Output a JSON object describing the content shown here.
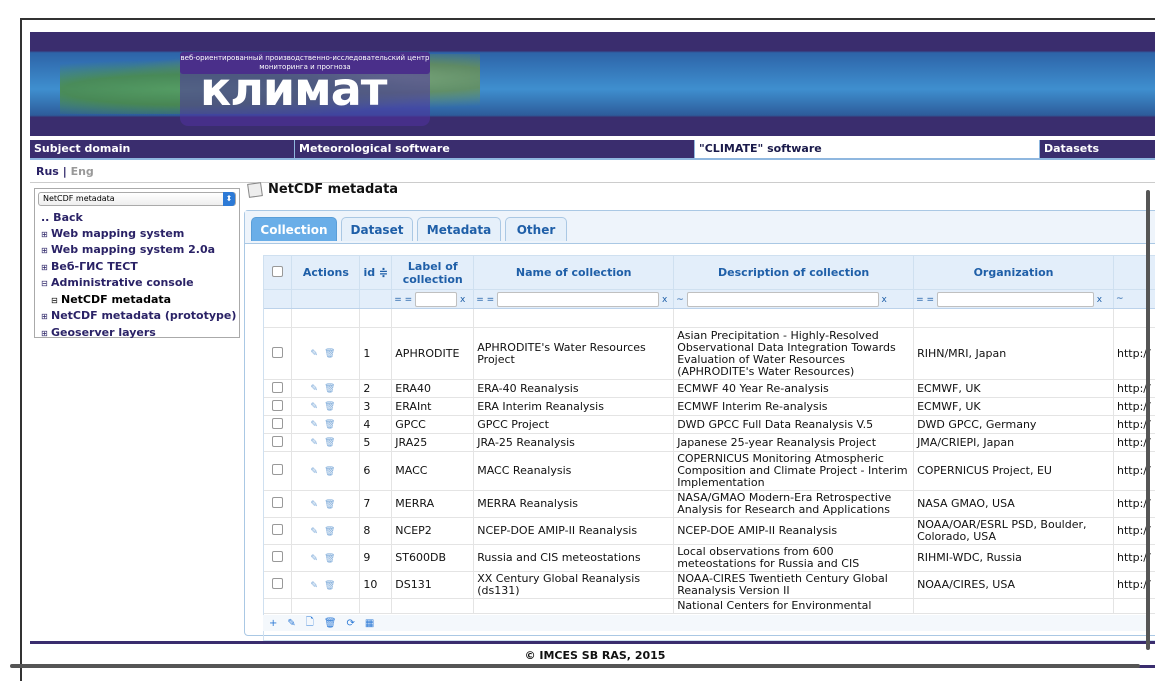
{
  "banner": {
    "subtitle": "веб-ориентированный производственно-исследовательский центр мониторинга и прогноза",
    "logo": "климат"
  },
  "nav": [
    "Subject domain",
    "Meteorological software",
    "\"CLIMATE\" software",
    "Datasets"
  ],
  "lang": {
    "rus": "Rus",
    "sep": "|",
    "eng": "Eng"
  },
  "sidebar": {
    "select_value": "NetCDF metadata",
    "items": [
      {
        "pm": "",
        "label": ".. Back"
      },
      {
        "pm": "⊞",
        "label": "Web mapping system"
      },
      {
        "pm": "⊞",
        "label": "Web mapping system 2.0a"
      },
      {
        "pm": "⊞",
        "label": "Веб-ГИС ТЕСТ"
      },
      {
        "pm": "⊟",
        "label": "Administrative console"
      },
      {
        "pm": "⊟",
        "label": "NetCDF metadata"
      },
      {
        "pm": "⊞",
        "label": "NetCDF metadata (prototype)"
      },
      {
        "pm": "⊞",
        "label": "Geoserver layers"
      }
    ]
  },
  "main": {
    "title": "NetCDF metadata"
  },
  "tabs": [
    "Collection",
    "Dataset",
    "Metadata",
    "Other"
  ],
  "table": {
    "headers": [
      "Actions",
      "id ≑",
      "Label of collection",
      "Name of collection",
      "Description of collection",
      "Organization"
    ],
    "filters": {
      "eq": "= =",
      "like": "~",
      "x": "x"
    },
    "rows": [
      {
        "id": "1",
        "label": "APHRODITE",
        "name": "APHRODITE's Water Resources Project",
        "desc": "Asian Precipitation - Highly-Resolved Observational Data Integration Towards Evaluation of Water Resources (APHRODITE's Water Resources)",
        "org": "RIHN/MRI, Japan",
        "url": "http://"
      },
      {
        "id": "2",
        "label": "ERA40",
        "name": "ERA-40 Reanalysis",
        "desc": "ECMWF 40 Year Re-analysis",
        "org": "ECMWF, UK",
        "url": "http://"
      },
      {
        "id": "3",
        "label": "ERAInt",
        "name": "ERA Interim Reanalysis",
        "desc": "ECMWF Interim Re-analysis",
        "org": "ECMWF, UK",
        "url": "http://"
      },
      {
        "id": "4",
        "label": "GPCC",
        "name": "GPCC Project",
        "desc": "DWD GPCC Full Data Reanalysis V.5",
        "org": "DWD GPCC, Germany",
        "url": "http://"
      },
      {
        "id": "5",
        "label": "JRA25",
        "name": "JRA-25 Reanalysis",
        "desc": "Japanese 25-year Reanalysis Project",
        "org": "JMA/CRIEPI, Japan",
        "url": "http://"
      },
      {
        "id": "6",
        "label": "MACC",
        "name": "MACC Reanalysis",
        "desc": "COPERNICUS Monitoring Atmospheric Composition and Climate Project - Interim Implementation",
        "org": "COPERNICUS Project, EU",
        "url": "http://"
      },
      {
        "id": "7",
        "label": "MERRA",
        "name": "MERRA Reanalysis",
        "desc": "NASA/GMAO Modern-Era Retrospective Analysis for Research and Applications",
        "org": "NASA GMAO, USA",
        "url": "http://"
      },
      {
        "id": "8",
        "label": "NCEP2",
        "name": "NCEP-DOE AMIP-II Reanalysis",
        "desc": "NCEP-DOE AMIP-II Reanalysis",
        "org": "NOAA/OAR/ESRL PSD, Boulder, Colorado, USA",
        "url": "http://"
      },
      {
        "id": "9",
        "label": "ST600DB",
        "name": "Russia and CIS meteostations",
        "desc": "Local observations from 600 meteostations for Russia and CIS",
        "org": "RIHMI-WDC, Russia",
        "url": "http://"
      },
      {
        "id": "10",
        "label": "DS131",
        "name": "XX Century Global Reanalysis (ds131)",
        "desc": "NOAA-CIRES Twentieth Century Global Reanalysis Version II",
        "org": "NOAA/CIRES, USA",
        "url": "http://"
      },
      {
        "id": "",
        "label": "",
        "name": "",
        "desc": "National Centers for Environmental",
        "org": "",
        "url": ""
      }
    ]
  },
  "toolbar": [
    "+",
    "✎",
    "🗋",
    "🗑",
    "⟳",
    "▦"
  ],
  "footer": "© IMCES SB RAS, 2015"
}
